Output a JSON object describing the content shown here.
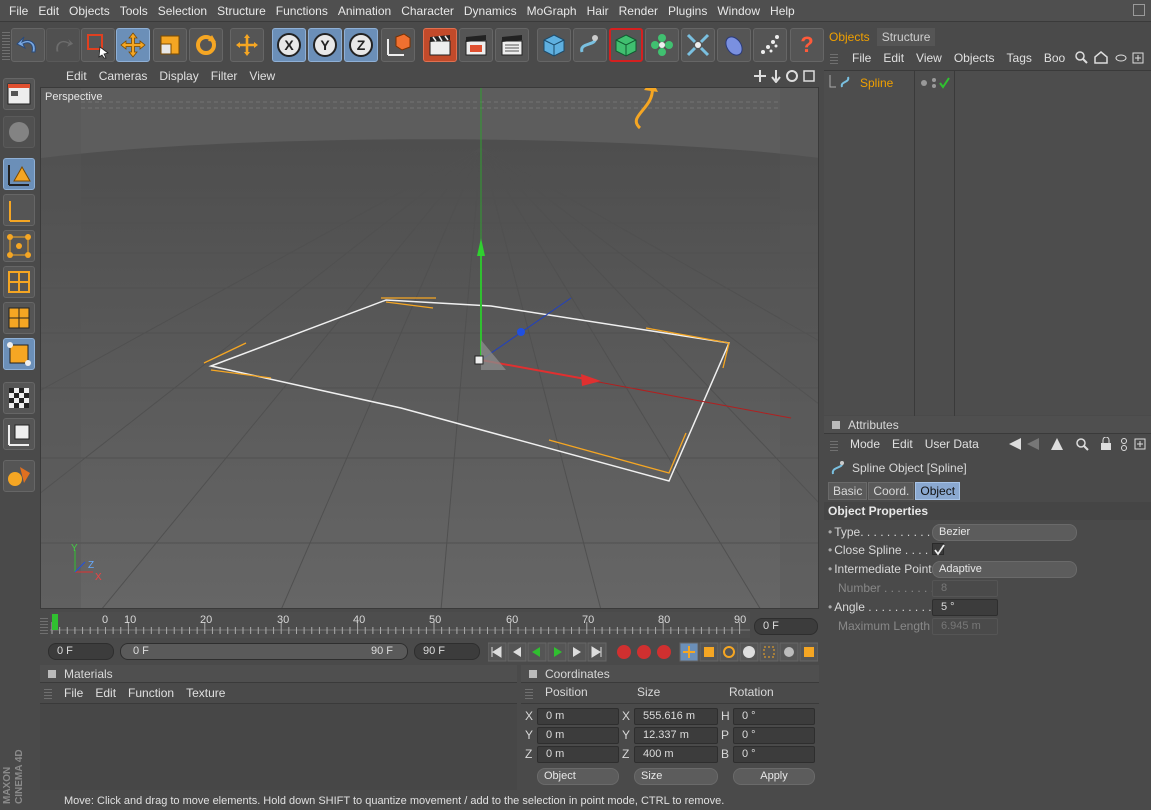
{
  "menu": [
    "File",
    "Edit",
    "Objects",
    "Tools",
    "Selection",
    "Structure",
    "Functions",
    "Animation",
    "Character",
    "Dynamics",
    "MoGraph",
    "Hair",
    "Render",
    "Plugins",
    "Window",
    "Help"
  ],
  "toolbar": {
    "x_label": "X",
    "y_label": "Y",
    "z_label": "Z",
    "help_label": "?"
  },
  "viewport": {
    "menu": [
      "Edit",
      "Cameras",
      "Display",
      "Filter",
      "View"
    ],
    "label": "Perspective",
    "axis_x": "X",
    "axis_y": "Y",
    "axis_z": "Z"
  },
  "timeline": {
    "ticks": [
      "0",
      "10",
      "20",
      "30",
      "40",
      "50",
      "60",
      "70",
      "80",
      "90"
    ],
    "current_frame": "0 F",
    "range_start": "0 F",
    "range_end": "90 F",
    "end_frame": "90 F"
  },
  "materials": {
    "title": "Materials",
    "menu": [
      "File",
      "Edit",
      "Function",
      "Texture"
    ]
  },
  "coordinates": {
    "title": "Coordinates",
    "headers": [
      "Position",
      "Size",
      "Rotation"
    ],
    "rows": [
      {
        "axis": "X",
        "pos": "0 m",
        "size_axis": "X",
        "size": "555.616 m",
        "rot_axis": "H",
        "rot": "0 °"
      },
      {
        "axis": "Y",
        "pos": "0 m",
        "size_axis": "Y",
        "size": "12.337 m",
        "rot_axis": "P",
        "rot": "0 °"
      },
      {
        "axis": "Z",
        "pos": "0 m",
        "size_axis": "Z",
        "size": "400 m",
        "rot_axis": "B",
        "rot": "0 °"
      }
    ],
    "mode": "Object",
    "size_mode": "Size",
    "apply": "Apply"
  },
  "objects_panel": {
    "tabs": [
      "Objects",
      "Structure"
    ],
    "menu": [
      "File",
      "Edit",
      "View",
      "Objects",
      "Tags",
      "Boo"
    ],
    "items": [
      {
        "name": "Spline"
      }
    ]
  },
  "attributes": {
    "title": "Attributes",
    "menu": [
      "Mode",
      "Edit",
      "User Data"
    ],
    "object_title": "Spline Object [Spline]",
    "tabs": [
      "Basic",
      "Coord.",
      "Object"
    ],
    "section": "Object Properties",
    "props": {
      "type_label": "Type. . . . . . . . . . .",
      "type_value": "Bezier",
      "close_label": "Close Spline . . . . .",
      "inter_label": "Intermediate Points",
      "inter_value": "Adaptive",
      "number_label": "Number . . . . . . . .",
      "number_value": "8",
      "angle_label": "Angle . . . . . . . . . .",
      "angle_value": "5 °",
      "maxlen_label": "Maximum Length",
      "maxlen_value": "6.945 m"
    }
  },
  "status": "Move: Click and drag to move elements. Hold down SHIFT to quantize movement / add to the selection in point mode, CTRL to remove.",
  "brand": {
    "line1": "MAXON",
    "line2": "CINEMA 4D"
  }
}
